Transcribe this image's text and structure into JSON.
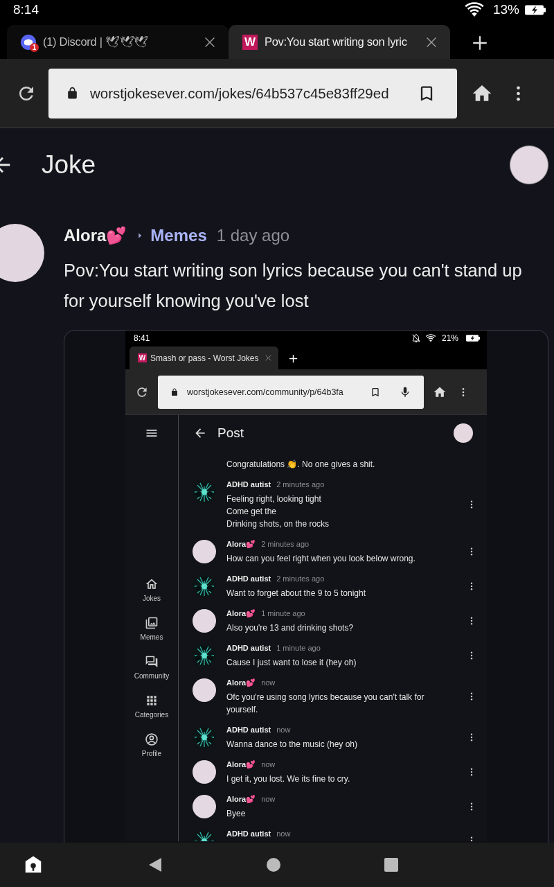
{
  "status_bar": {
    "time": "8:14",
    "battery": "13%"
  },
  "tabs": [
    {
      "title": "(1) Discord | 🕊🕊🕊",
      "kind": "discord",
      "badge": "1",
      "selected": false
    },
    {
      "title": "Pov:You start writing son lyric",
      "kind": "letter",
      "letter": "W",
      "selected": true
    }
  ],
  "toolbar": {
    "url": "worstjokesever.com/jokes/64b537c45e83ff29ed"
  },
  "page": {
    "title": "Joke"
  },
  "post": {
    "author": "Alora💕",
    "category": "Memes",
    "time": "1 day ago",
    "text": "Pov:You start writing son lyrics because you can't stand up for yourself knowing you've lost"
  },
  "screenshot": {
    "status_bar": {
      "time": "8:41",
      "battery": "21%"
    },
    "tab": {
      "letter": "W",
      "title": "Smash or pass - Worst Jokes"
    },
    "url": "worstjokesever.com/community/p/64b3fa",
    "sidebar": [
      {
        "label": "Jokes",
        "kind": "home"
      },
      {
        "label": "Memes",
        "kind": "images"
      },
      {
        "label": "Community",
        "kind": "forum"
      },
      {
        "label": "Categories",
        "kind": "grid"
      },
      {
        "label": "Profile",
        "kind": "account"
      }
    ],
    "title": "Post",
    "comments": [
      {
        "body": [
          "Congratulations 👏. No one gives a shit."
        ]
      },
      {
        "kind": "fractal",
        "author": "ADHD autist",
        "time": "2 minutes ago",
        "body": [
          "Feeling right, looking tight",
          "Come get the",
          "Drinking shots, on the rocks"
        ]
      },
      {
        "kind": "plain",
        "author": "Alora💕",
        "time": "2 minutes ago",
        "body": [
          "How can you feel right when you look below wrong."
        ]
      },
      {
        "kind": "fractal",
        "author": "ADHD autist",
        "time": "2 minutes ago",
        "body": [
          "Want to forget about the 9 to 5 tonight"
        ]
      },
      {
        "kind": "plain",
        "author": "Alora💕",
        "time": "1 minute ago",
        "body": [
          "Also you're 13 and drinking shots?"
        ]
      },
      {
        "kind": "fractal",
        "author": "ADHD autist",
        "time": "1 minute ago",
        "body": [
          "Cause I just want to lose it (hey oh)"
        ]
      },
      {
        "kind": "plain",
        "author": "Alora💕",
        "time": "now",
        "body": [
          "Ofc you're using song lyrics because you can't talk for yourself."
        ]
      },
      {
        "kind": "fractal",
        "author": "ADHD autist",
        "time": "now",
        "body": [
          "Wanna dance to the music (hey oh)"
        ]
      },
      {
        "kind": "plain",
        "author": "Alora💕",
        "time": "now",
        "body": [
          "I get it, you lost. We its fine to cry."
        ]
      },
      {
        "kind": "plain",
        "author": "Alora💕",
        "time": "now",
        "body": [
          "Byee"
        ]
      },
      {
        "kind": "fractal",
        "author": "ADHD autist",
        "time": "now"
      }
    ]
  }
}
